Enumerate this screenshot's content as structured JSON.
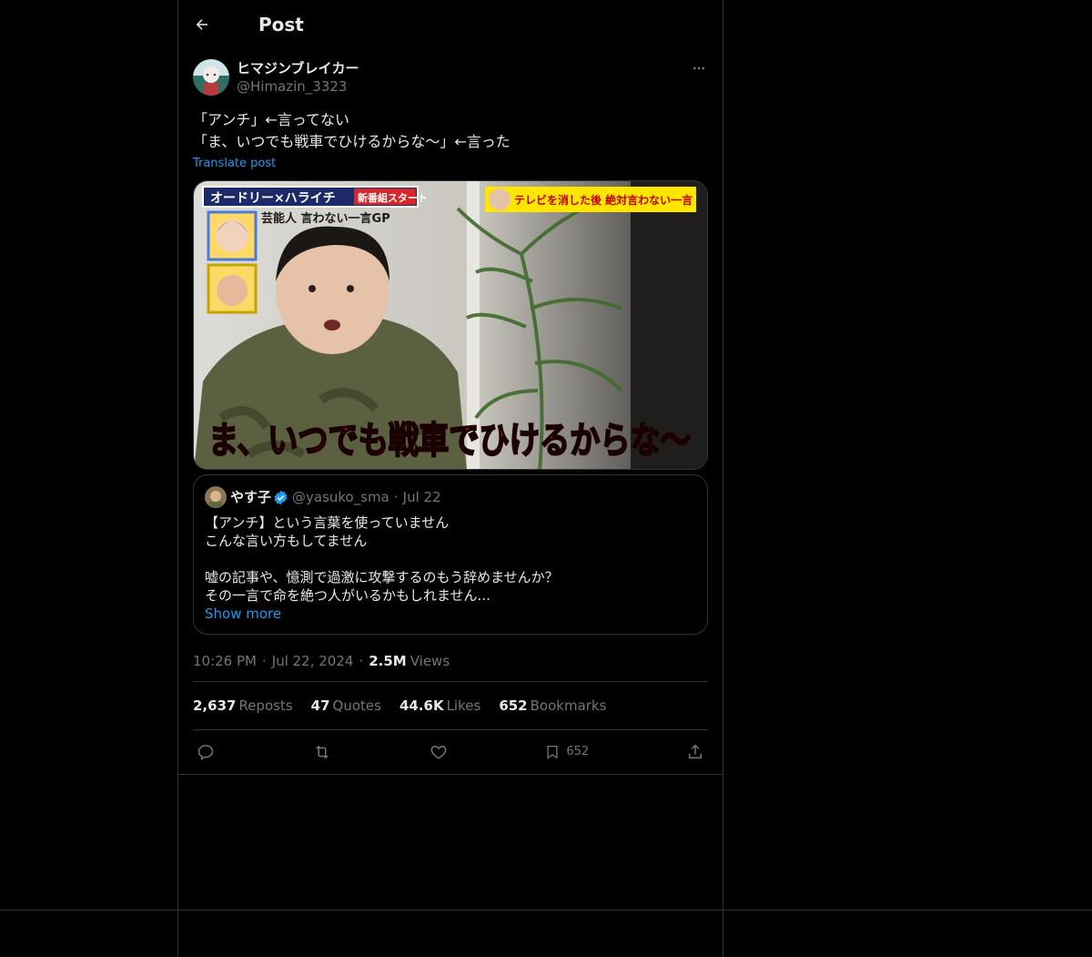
{
  "header": {
    "title": "Post"
  },
  "post": {
    "display_name": "ヒマジンブレイカー",
    "handle": "@Himazin_3323",
    "text_line1": "「アンチ」←言ってない",
    "text_line2": "「ま、いつでも戦車でひけるからな〜」←言った",
    "translate_label": "Translate post",
    "media": {
      "top_banner": "オードリー×ハライチ",
      "top_banner_tag": "新番組スタート",
      "sub_banner": "芸能人 言わない一言GP",
      "corner_banner": "テレビを消した後 絶対言わない一言",
      "caption": "ま、いつでも戦車でひけるからな〜"
    },
    "timestamp_time": "10:26 PM",
    "timestamp_date": "Jul 22, 2024",
    "views_count": "2.5M",
    "views_label": "Views"
  },
  "quote": {
    "name": "やす子",
    "handle": "@yasuko_sma",
    "date": "Jul 22",
    "text": "【アンチ】という言葉を使っていません\nこんな言い方もしてません\n\n嘘の記事や、憶測で過激に攻撃するのもう辞めませんか？\nその一言で命を絶つ人がいるかもしれません...",
    "show_more": "Show more"
  },
  "stats": {
    "reposts_count": "2,637",
    "reposts_label": "Reposts",
    "quotes_count": "47",
    "quotes_label": "Quotes",
    "likes_count": "44.6K",
    "likes_label": "Likes",
    "bookmarks_count": "652",
    "bookmarks_label": "Bookmarks"
  },
  "actions": {
    "bookmark_count": "652"
  },
  "colors": {
    "background": "#000000",
    "text": "#e7e9ea",
    "muted": "#71767b",
    "accent": "#1d9bf0",
    "border": "#2f3336"
  }
}
